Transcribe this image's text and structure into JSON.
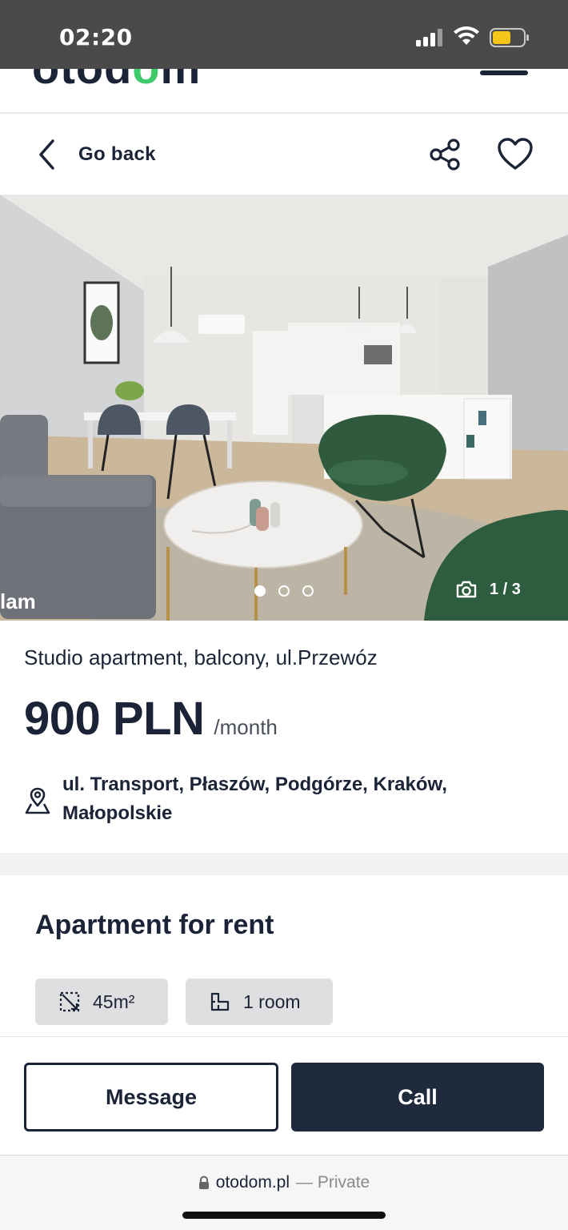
{
  "status_bar": {
    "time": "02:20",
    "battery_color": "#f5c518"
  },
  "header": {
    "logo_text_a": "otod",
    "logo_text_b": "m",
    "brand_green": "#3ec96a"
  },
  "nav": {
    "back_label": "Go back",
    "share_icon": "share-icon",
    "favorite_icon": "heart-icon"
  },
  "gallery": {
    "counter": "1 / 3",
    "watermark": "lam",
    "total_images": 3,
    "current_index": 1
  },
  "listing": {
    "title": "Studio apartment, balcony, ul.Przewóz",
    "price": "900 PLN",
    "price_period": "/month",
    "location_line1": "ul. Transport, Płaszów, Podgórze, Kraków,",
    "location_line2": "Małopolskie"
  },
  "details": {
    "section_title": "Apartment for rent",
    "area": "45m²",
    "rooms": "1 room"
  },
  "actions": {
    "message_label": "Message",
    "call_label": "Call",
    "primary_color": "#1f2a3d"
  },
  "browser": {
    "domain": "otodom.pl",
    "privacy": "— Private"
  }
}
